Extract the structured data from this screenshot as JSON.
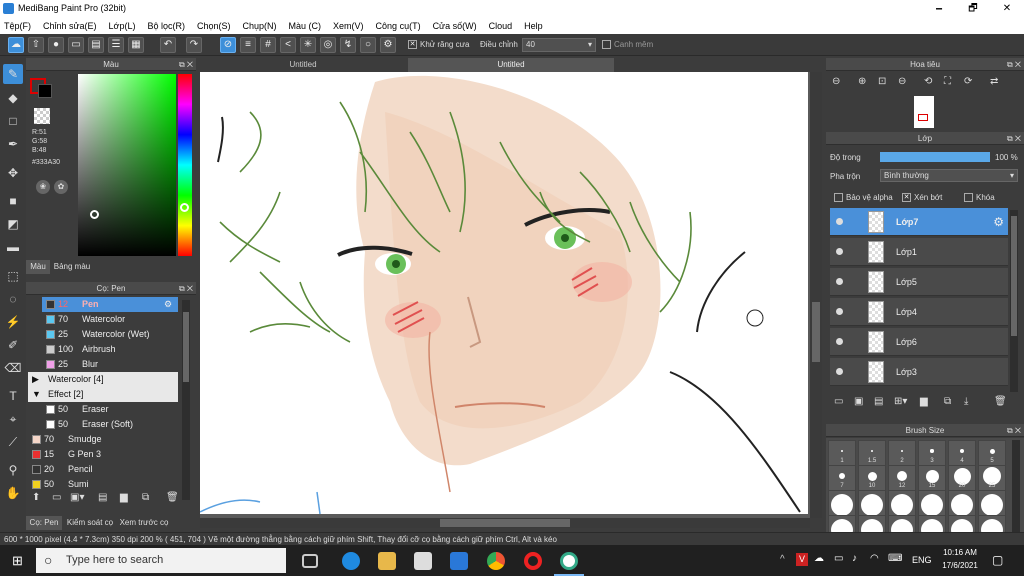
{
  "window": {
    "title": "MediBang Paint Pro (32bit)",
    "minimize": "🗕",
    "maximize": "🗗",
    "close": "✕"
  },
  "menu": [
    "Tệp(F)",
    "Chỉnh sửa(E)",
    "Lớp(L)",
    "Bộ lọc(R)",
    "Chọn(S)",
    "Chụp(N)",
    "Màu (C)",
    "Xem(V)",
    "Công cụ(T)",
    "Cửa số(W)",
    "Cloud",
    "Help"
  ],
  "toolbar": {
    "antialias_label": "Khử răng cưa",
    "adjust_label": "Điều chỉnh",
    "adjust_value": "40",
    "smooth_label": "Canh mêm"
  },
  "color_panel": {
    "title": "Màu",
    "r": "R:51",
    "g": "G:58",
    "b": "B:48",
    "hex": "#333A30",
    "tab_color": "Màu",
    "tab_palette": "Bảng màu",
    "primary": "#333A30"
  },
  "brush_panel": {
    "title": "Cọ: Pen",
    "rows": [
      {
        "size": "12",
        "name": "Pen",
        "swatch": "#333333",
        "selected": true,
        "indent": true
      },
      {
        "size": "70",
        "name": "Watercolor",
        "swatch": "#5bc8f0",
        "indent": true
      },
      {
        "size": "25",
        "name": "Watercolor (Wet)",
        "swatch": "#5bc8f0",
        "indent": true
      },
      {
        "size": "100",
        "name": "Airbrush",
        "swatch": "#cccccc",
        "indent": true
      },
      {
        "size": "25",
        "name": "Blur",
        "swatch": "#f0a0e8",
        "indent": true
      },
      {
        "size": "",
        "name": "Watercolor [4]",
        "group": true,
        "arrow": "▶"
      },
      {
        "size": "",
        "name": "Effect [2]",
        "group": true,
        "arrow": "▼"
      },
      {
        "size": "50",
        "name": "Eraser",
        "swatch": "#ffffff",
        "indent": true
      },
      {
        "size": "50",
        "name": "Eraser (Soft)",
        "swatch": "#ffffff",
        "indent": true
      },
      {
        "size": "70",
        "name": "Smudge",
        "swatch": "#f5d6c8"
      },
      {
        "size": "15",
        "name": "G Pen 3",
        "swatch": "#e83030"
      },
      {
        "size": "20",
        "name": "Pencil",
        "swatch": "#333333"
      },
      {
        "size": "50",
        "name": "Sumi",
        "swatch": "#f0d020"
      }
    ],
    "tabs": [
      "Cọ: Pen",
      "Kiểm soát cọ",
      "Xem trước cọ"
    ]
  },
  "canvas_tabs": [
    "Untitled",
    "Untitled"
  ],
  "navigator": {
    "title": "Hoa tiêu"
  },
  "layer_panel": {
    "title": "Lớp",
    "opacity_label": "Độ trong",
    "opacity_value": "100 %",
    "opacity_fraction": 1.0,
    "blend_label": "Pha trộn",
    "blend_value": "Bình thường",
    "protect_alpha": "Bảo vệ alpha",
    "clipping": "Xén bớt",
    "lock": "Khóa",
    "layers": [
      "Lớp7",
      "Lớp1",
      "Lớp5",
      "Lớp4",
      "Lớp6",
      "Lớp3"
    ]
  },
  "brush_size": {
    "title": "Brush Size",
    "labels": [
      "1",
      "1.5",
      "2",
      "3",
      "4",
      "5",
      "7",
      "10",
      "12",
      "15",
      "20",
      "25"
    ]
  },
  "status": "600 * 1000 pixel   (4.4 * 7.3cm)   350 dpi   200 %   ( 451, 704 )   Vẽ một đường thẳng bằng cách giữ phím Shift, Thay đổi cỡ cọ bằng cách giữ phím Ctrl, Alt và kéo",
  "taskbar": {
    "search": "Type here to search",
    "language": "ENG",
    "time": "10:16 AM",
    "date": "17/6/2021"
  }
}
